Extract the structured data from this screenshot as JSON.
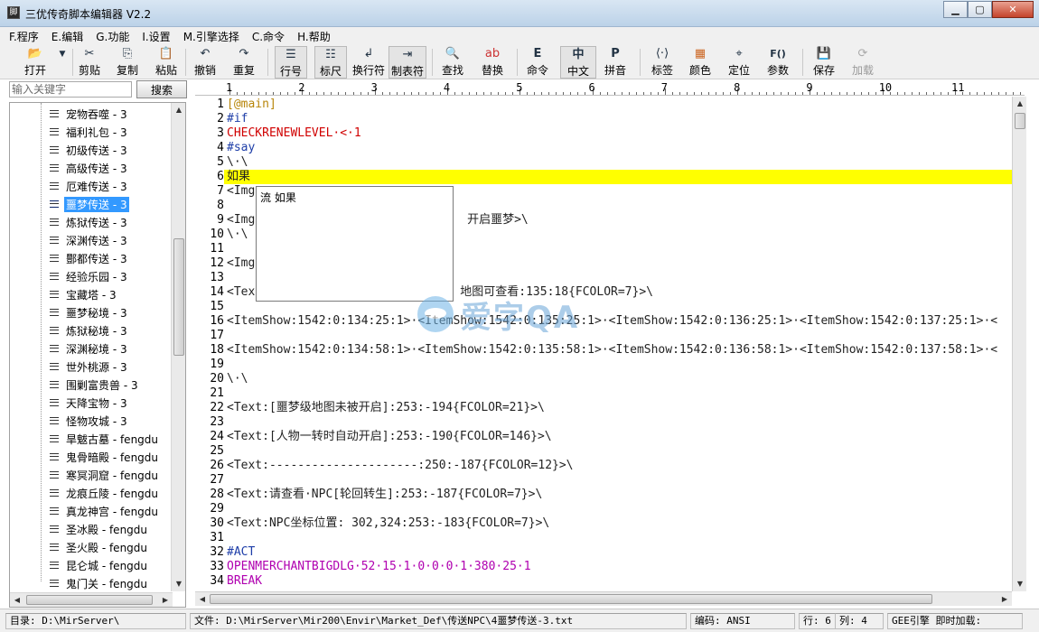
{
  "window": {
    "title": "三优传奇脚本编辑器 V2.2",
    "icon_text": "脚",
    "buttons": [
      "minimize-icon",
      "maximize-icon",
      "close-icon"
    ]
  },
  "menu": [
    "F.程序",
    "E.编辑",
    "G.功能",
    "I.设置",
    "M.引擎选择",
    "C.命令",
    "H.帮助"
  ],
  "toolbar": [
    {
      "label": "打开",
      "icon": "open-folder-icon"
    },
    {
      "label": "",
      "icon": "dropdown-arrow-icon"
    },
    {
      "label": "剪贴",
      "icon": "scissors-icon"
    },
    {
      "label": "复制",
      "icon": "copy-icon"
    },
    {
      "label": "粘贴",
      "icon": "paste-icon"
    },
    {
      "label": "撤销",
      "icon": "undo-icon"
    },
    {
      "label": "重复",
      "icon": "redo-icon"
    },
    {
      "label": "行号",
      "icon": "line-number-icon"
    },
    {
      "label": "标尺",
      "icon": "ruler-icon"
    },
    {
      "label": "换行符",
      "icon": "newline-icon"
    },
    {
      "label": "制表符",
      "icon": "tab-icon"
    },
    {
      "label": "查找",
      "icon": "find-icon"
    },
    {
      "label": "替换",
      "icon": "replace-icon"
    },
    {
      "label": "命令",
      "icon": "command-icon"
    },
    {
      "label": "中文",
      "icon": "chinese-icon"
    },
    {
      "label": "拼音",
      "icon": "pinyin-icon"
    },
    {
      "label": "标签",
      "icon": "tag-icon"
    },
    {
      "label": "颜色",
      "icon": "color-icon"
    },
    {
      "label": "定位",
      "icon": "locate-icon"
    },
    {
      "label": "参数",
      "icon": "params-icon"
    },
    {
      "label": "保存",
      "icon": "save-icon"
    },
    {
      "label": "加载",
      "icon": "load-icon"
    }
  ],
  "toolbar_glyphs": {
    "command": "E",
    "chinese": "中",
    "pinyin": "P",
    "params": "F()"
  },
  "search": {
    "placeholder": "输入关键字",
    "button": "搜索"
  },
  "tree": {
    "items": [
      "宠物吞噬 - 3",
      "福利礼包 - 3",
      "初级传送 - 3",
      "高级传送 - 3",
      "厄难传送 - 3",
      "噩梦传送 - 3",
      "炼狱传送 - 3",
      "深渊传送 - 3",
      "酆都传送 - 3",
      "经验乐园 - 3",
      "宝藏塔 - 3",
      "噩梦秘境 - 3",
      "炼狱秘境 - 3",
      "深渊秘境 - 3",
      "世外桃源 - 3",
      "围剿富贵兽 - 3",
      "天降宝物 - 3",
      "怪物攻城 - 3",
      "旱魃古墓 - fengdu",
      "鬼骨暗殿 - fengdu",
      "寒冥洞窟 - fengdu",
      "龙痕丘陵 - fengdu",
      "真龙神宫 - fengdu",
      "圣冰殿 - fengdu",
      "圣火殿 - fengdu",
      "昆仑城 - fengdu",
      "鬼门关 - fengdu"
    ],
    "selected_index": 5
  },
  "ruler_numbers": [
    "1",
    "2",
    "3",
    "4",
    "5",
    "6",
    "7",
    "8",
    "9",
    "10",
    "11"
  ],
  "editor": {
    "lines": [
      {
        "n": "1",
        "t": "[@main]",
        "c": "label"
      },
      {
        "n": "2",
        "t": "#if",
        "c": "kw"
      },
      {
        "n": "3",
        "t": "CHECKRENEWLEVEL·<·1",
        "c": "red"
      },
      {
        "n": "4",
        "t": "#say",
        "c": "kw"
      },
      {
        "n": "5",
        "t": "\\·\\",
        "c": "black"
      },
      {
        "n": "6",
        "t": "如果",
        "c": "black",
        "highlight": true
      },
      {
        "n": "7",
        "t": "<Img",
        "c": "black"
      },
      {
        "n": "8",
        "t": "",
        "c": "black"
      },
      {
        "n": "9",
        "t": "<Img                              开启噩梦>\\",
        "c": "black"
      },
      {
        "n": "10",
        "t": "\\·\\",
        "c": "black"
      },
      {
        "n": "11",
        "t": "",
        "c": "black"
      },
      {
        "n": "12",
        "t": "<Img",
        "c": "black"
      },
      {
        "n": "13",
        "t": "",
        "c": "black"
      },
      {
        "n": "14",
        "t": "<Text                            地图可查看:135:18{FCOLOR=7}>\\",
        "c": "black"
      },
      {
        "n": "15",
        "t": "",
        "c": "black"
      },
      {
        "n": "16",
        "t": "<ItemShow:1542:0:134:25:1>·<ItemShow:1542:0:135:25:1>·<ItemShow:1542:0:136:25:1>·<ItemShow:1542:0:137:25:1>·<",
        "c": "black"
      },
      {
        "n": "17",
        "t": "",
        "c": "black"
      },
      {
        "n": "18",
        "t": "<ItemShow:1542:0:134:58:1>·<ItemShow:1542:0:135:58:1>·<ItemShow:1542:0:136:58:1>·<ItemShow:1542:0:137:58:1>·<",
        "c": "black"
      },
      {
        "n": "19",
        "t": "",
        "c": "black"
      },
      {
        "n": "20",
        "t": "\\·\\",
        "c": "black"
      },
      {
        "n": "21",
        "t": "",
        "c": "black"
      },
      {
        "n": "22",
        "t": "<Text:[噩梦级地图未被开启]:253:-194{FCOLOR=21}>\\",
        "c": "black"
      },
      {
        "n": "23",
        "t": "",
        "c": "black"
      },
      {
        "n": "24",
        "t": "<Text:[人物一转时自动开启]:253:-190{FCOLOR=146}>\\",
        "c": "black"
      },
      {
        "n": "25",
        "t": "",
        "c": "black"
      },
      {
        "n": "26",
        "t": "<Text:---------------------:250:-187{FCOLOR=12}>\\",
        "c": "black"
      },
      {
        "n": "27",
        "t": "",
        "c": "black"
      },
      {
        "n": "28",
        "t": "<Text:请查看·NPC[轮回转生]:253:-187{FCOLOR=7}>\\",
        "c": "black"
      },
      {
        "n": "29",
        "t": "",
        "c": "black"
      },
      {
        "n": "30",
        "t": "<Text:NPC坐标位置: 302,324:253:-183{FCOLOR=7}>\\",
        "c": "black"
      },
      {
        "n": "31",
        "t": "",
        "c": "black"
      },
      {
        "n": "32",
        "t": "#ACT",
        "c": "kw"
      },
      {
        "n": "33",
        "t": "OPENMERCHANTBIGDLG·52·15·1·0·0·0·1·380·25·1",
        "c": "pink"
      },
      {
        "n": "34",
        "t": "BREAK",
        "c": "pink"
      }
    ]
  },
  "popup": {
    "item": "流 如果"
  },
  "watermark": {
    "text": "爱字QA"
  },
  "status": {
    "dir": "目录: D:\\MirServer\\",
    "file": "文件: D:\\MirServer\\Mir200\\Envir\\Market_Def\\传送NPC\\4噩梦传送-3.txt",
    "encoding": "编码: ANSI",
    "row": "行: 6",
    "col": "列: 4",
    "engine": "GEE引擎  即时加载:"
  },
  "colors": {
    "highlight": "#ffff00",
    "selection": "#3399ff",
    "label": "#b8860b",
    "keyword": "#1e3ea8",
    "command": "#d00000",
    "action": "#b000b0"
  }
}
